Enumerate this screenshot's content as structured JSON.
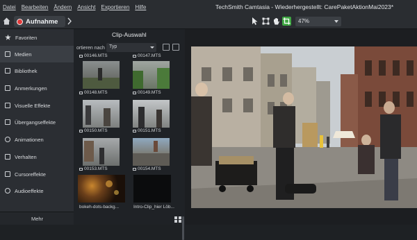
{
  "app": {
    "menu": [
      "Datei",
      "Bearbeiten",
      "Ändern",
      "Ansicht",
      "Exportieren",
      "Hilfe"
    ],
    "title": "TechSmith Camtasia - Wiederhergestellt: CarePaketAktionMai2023*"
  },
  "toolbar": {
    "record_label": "Aufnahme",
    "zoom_value": "47%"
  },
  "sidebar": {
    "items": [
      {
        "label": "Favoriten",
        "icon": "star-icon"
      },
      {
        "label": "Medien",
        "icon": "media-icon"
      },
      {
        "label": "Bibliothek",
        "icon": "library-icon"
      },
      {
        "label": "Anmerkungen",
        "icon": "annotation-icon"
      },
      {
        "label": "Visuelle Effekte",
        "icon": "visual-effects-icon"
      },
      {
        "label": "Übergangseffekte",
        "icon": "transition-icon"
      },
      {
        "label": "Animationen",
        "icon": "animation-icon"
      },
      {
        "label": "Verhalten",
        "icon": "behavior-icon"
      },
      {
        "label": "Cursoreffekte",
        "icon": "cursor-icon"
      },
      {
        "label": "Audioeffekte",
        "icon": "audio-icon"
      }
    ],
    "active_index": 1,
    "more_label": "Mehr"
  },
  "clips": {
    "title": "Clip-Auswahl",
    "sort_label": "ortieren nach",
    "sort_value": "Typ",
    "items": [
      {
        "name": "00146.MTS"
      },
      {
        "name": "00147.MTS"
      },
      {
        "name": "00148.MTS"
      },
      {
        "name": "00149.MTS"
      },
      {
        "name": "00150.MTS"
      },
      {
        "name": "00151.MTS"
      },
      {
        "name": "00153.MTS"
      },
      {
        "name": "00154.MTS"
      },
      {
        "name": "bokeh-dots-backg..."
      },
      {
        "name": "Intro-Clip_hier Löb..."
      }
    ]
  },
  "colors": {
    "accent_green": "#3fa743",
    "record_red": "#e23b3b"
  }
}
